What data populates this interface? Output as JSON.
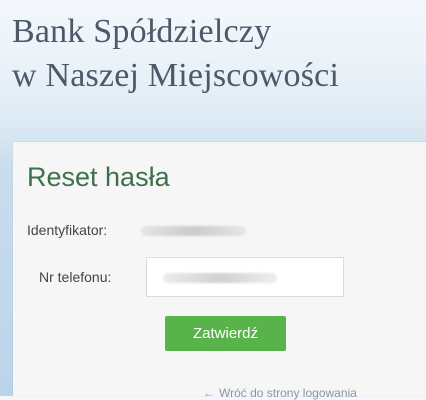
{
  "header": {
    "bank_title_line1": "Bank Spółdzielczy",
    "bank_title_line2": "w Naszej Miejscowości"
  },
  "form": {
    "title": "Reset hasła",
    "identifier_label": "Identyfikator:",
    "phone_label": "Nr telefonu:",
    "submit_label": "Zatwierdź",
    "back_link_label": "Wróć do strony logowania",
    "back_arrow_icon": "arrow-left-icon"
  },
  "colors": {
    "title_green": "#3f6f4b",
    "button_green": "#58b34a",
    "link_gray": "#8c96a0"
  }
}
